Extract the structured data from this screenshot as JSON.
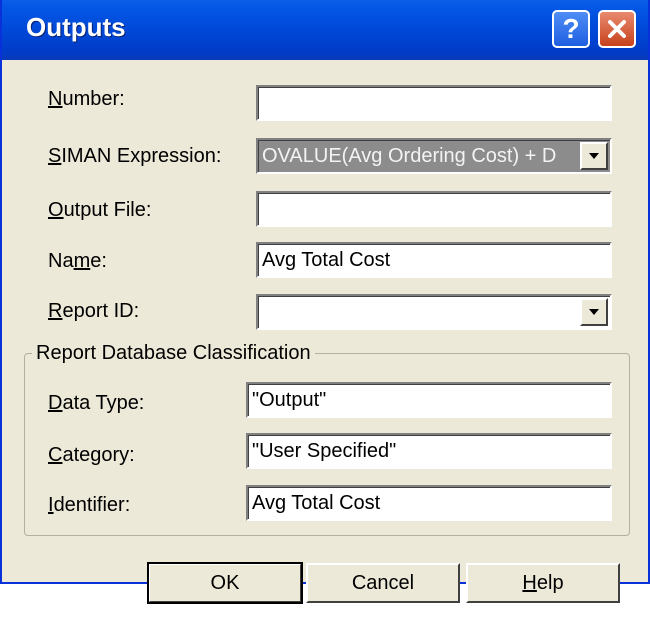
{
  "window": {
    "title": "Outputs"
  },
  "fields": {
    "number": {
      "label_u": "N",
      "label_rest": "umber:",
      "value": ""
    },
    "siman": {
      "label_u": "S",
      "label_rest": "IMAN Expression:",
      "value": "OVALUE(Avg Ordering Cost) + D"
    },
    "output_file": {
      "label_u": "O",
      "label_rest": "utput File:",
      "value": ""
    },
    "name": {
      "label_pre": "Na",
      "label_u": "m",
      "label_rest": "e:",
      "value": "Avg Total Cost"
    },
    "report_id": {
      "label_u": "R",
      "label_rest": "eport ID:",
      "value": ""
    }
  },
  "group": {
    "title": "Report Database Classification",
    "data_type": {
      "label_u": "D",
      "label_rest": "ata Type:",
      "value": "\"Output\""
    },
    "category": {
      "label_u": "C",
      "label_rest": "ategory:",
      "value": "\"User Specified\""
    },
    "identifier": {
      "label_u": "I",
      "label_rest": "dentifier:",
      "value": "Avg Total Cost"
    }
  },
  "buttons": {
    "ok": "OK",
    "cancel": "Cancel",
    "help_u": "H",
    "help_rest": "elp"
  },
  "icons": {
    "help": "question-mark-icon",
    "close": "close-x-icon",
    "dropdown": "down-arrow-icon"
  },
  "colors": {
    "titlebar": "#0048d8",
    "dialog": "#ece9d8",
    "close": "#c8411c"
  }
}
